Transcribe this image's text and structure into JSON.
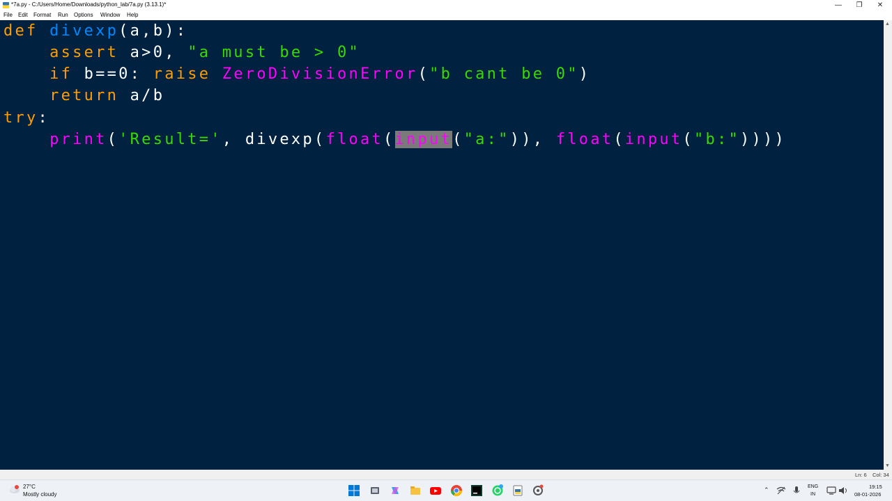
{
  "window": {
    "title": "*7a.py - C:/Users/Home/Downloads/python_lab/7a.py (3.13.1)*",
    "minimize_glyph": "—",
    "maximize_glyph": "❐",
    "close_glyph": "✕"
  },
  "menu": [
    "File",
    "Edit",
    "Format",
    "Run",
    "Options",
    "Window",
    "Help"
  ],
  "code": {
    "line1": {
      "kw_def": "def",
      "sp1": " ",
      "fn_name": "divexp",
      "rest": "(a,b):"
    },
    "line2": {
      "indent": "    ",
      "kw_assert": "assert",
      "mid": " a>0, ",
      "str": "\"a must be > 0\""
    },
    "line3": {
      "indent": "    ",
      "kw_if": "if",
      "mid1": " b==0: ",
      "kw_raise": "raise",
      "sp": " ",
      "exc": "ZeroDivisionError",
      "p1": "(",
      "str": "\"b cant be 0\"",
      "p2": ")"
    },
    "line4": {
      "indent": "    ",
      "kw_return": "return",
      "rest": " a/b"
    },
    "line5": {
      "kw_try": "try",
      "colon": ":"
    },
    "line6": {
      "indent": "    ",
      "print": "print",
      "p1": "(",
      "str1": "'Result='",
      "mid1": ", divexp(",
      "float1": "float",
      "p2": "(",
      "input1": "input",
      "p3": "(",
      "str2": "\"a:\"",
      "p4": ")), ",
      "float2": "float",
      "p5": "(",
      "input2": "input",
      "p6": "(",
      "str3": "\"b:\"",
      "p7": "))))"
    }
  },
  "status": {
    "line": "Ln: 6",
    "col": "Col: 34"
  },
  "taskbar": {
    "weather_temp": "27°C",
    "weather_desc": "Mostly cloudy",
    "icons": [
      "windows-start-icon",
      "task-view-icon",
      "copilot-icon",
      "file-explorer-icon",
      "youtube-icon",
      "chrome-icon",
      "pycharm-icon",
      "whatsapp-icon",
      "idle-icon",
      "settings-icon"
    ],
    "lang_line1": "ENG",
    "lang_line2": "IN",
    "time": "19:15",
    "date": "08-01-2026"
  },
  "colors": {
    "editor_bg": "#002240",
    "keyword": "#ff9d00",
    "string": "#3ad900",
    "function_name": "#0088ff",
    "builtin": "#ff00ff",
    "selection": "#7a7a7a"
  }
}
